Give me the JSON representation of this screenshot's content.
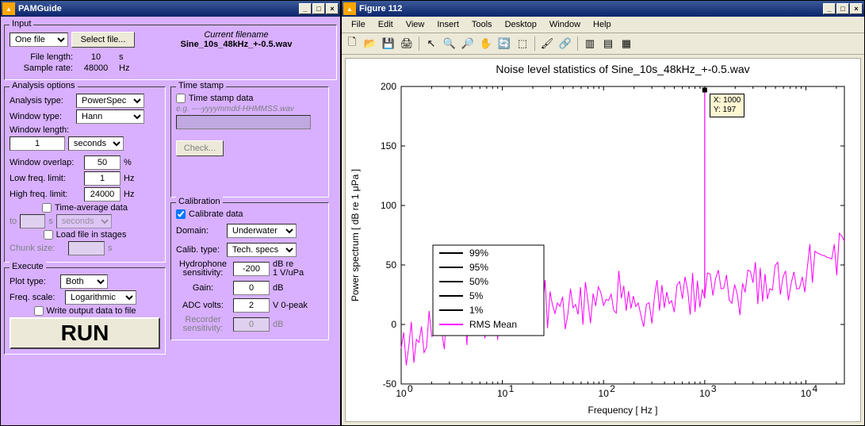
{
  "pam": {
    "title": "PAMGuide",
    "input": {
      "legend": "Input",
      "source": "One file",
      "selectFileBtn": "Select file...",
      "currentFilenameLabel": "Current filename",
      "currentFilename": "Sine_10s_48kHz_+-0.5.wav",
      "fileLengthLabel": "File length:",
      "fileLength": "10",
      "fileLengthUnit": "s",
      "sampleRateLabel": "Sample rate:",
      "sampleRate": "48000",
      "sampleRateUnit": "Hz"
    },
    "analysis": {
      "legend": "Analysis options",
      "analysisTypeLabel": "Analysis type:",
      "analysisType": "PowerSpec",
      "windowTypeLabel": "Window type:",
      "windowType": "Hann",
      "windowLengthLabel": "Window length:",
      "windowLength": "1",
      "windowLengthUnit": "seconds",
      "windowOverlapLabel": "Window overlap:",
      "windowOverlap": "50",
      "windowOverlapUnit": "%",
      "lowFreqLabel": "Low freq. limit:",
      "lowFreq": "1",
      "lowFreqUnit": "Hz",
      "highFreqLabel": "High freq. limit:",
      "highFreq": "24000",
      "highFreqUnit": "Hz",
      "timeAverageLabel": "Time-average data",
      "timeAverageChecked": false,
      "taFromLabel": "to",
      "taFrom": "",
      "taFromUnit": "s",
      "taUnit": "seconds",
      "loadStagesLabel": "Load file in stages",
      "loadStagesChecked": false,
      "chunkSizeLabel": "Chunk size:",
      "chunkSize": "",
      "chunkSizeUnit": "s"
    },
    "timestamp": {
      "legend": "Time stamp",
      "tsLabel": "Time stamp data",
      "tsChecked": false,
      "tsHint": "e.g. ----yyyymmdd-HHMMSS.wav",
      "tsValue": "",
      "checkBtn": "Check..."
    },
    "calibration": {
      "legend": "Calibration",
      "calLabel": "Calibrate data",
      "calChecked": true,
      "domainLabel": "Domain:",
      "domain": "Underwater",
      "calibTypeLabel": "Calib. type:",
      "calibType": "Tech. specs",
      "hydroLabel1": "Hydrophone",
      "hydroLabel2": "sensitivity:",
      "hydro": "-200",
      "hydroUnit1": "dB re",
      "hydroUnit2": "1 V/uPa",
      "gainLabel": "Gain:",
      "gain": "0",
      "gainUnit": "dB",
      "adcLabel": "ADC volts:",
      "adc": "2",
      "adcUnit": "V 0-peak",
      "recorderLabel1": "Recorder",
      "recorderLabel2": "sensitivity:",
      "recorder": "0",
      "recorderUnit": "dB"
    },
    "execute": {
      "legend": "Execute",
      "plotTypeLabel": "Plot type:",
      "plotType": "Both",
      "freqScaleLabel": "Freq. scale:",
      "freqScale": "Logarithmic",
      "writeLabel": "Write output data to file",
      "writeChecked": false,
      "runBtn": "RUN"
    }
  },
  "fig": {
    "title": "Figure 112",
    "menus": [
      "File",
      "Edit",
      "View",
      "Insert",
      "Tools",
      "Desktop",
      "Window",
      "Help"
    ],
    "toolbarIcons": [
      "new",
      "open",
      "save",
      "print",
      "arrow",
      "zoom-in",
      "zoom-out",
      "pan",
      "rotate",
      "cursor",
      "brush",
      "link",
      "colorbar",
      "legend",
      "grid"
    ]
  },
  "chart_data": {
    "type": "line",
    "title": "Noise level statistics of Sine_10s_48kHz_+-0.5.wav",
    "xlabel": "Frequency [ Hz ]",
    "ylabel": "Power spectrum [ dB re 1 μPa ]",
    "xlog": true,
    "xlim": [
      1,
      24000
    ],
    "ylim": [
      -50,
      200
    ],
    "yticks": [
      -50,
      0,
      50,
      100,
      150,
      200
    ],
    "xticks_exp": [
      0,
      1,
      2,
      3,
      4
    ],
    "series": [
      {
        "name": "99%",
        "color": "#000",
        "x": [],
        "values": []
      },
      {
        "name": "95%",
        "color": "#000",
        "x": [],
        "values": []
      },
      {
        "name": "50%",
        "color": "#000",
        "x": [],
        "values": []
      },
      {
        "name": "5%",
        "color": "#000",
        "x": [],
        "values": []
      },
      {
        "name": "1%",
        "color": "#000",
        "x": [],
        "values": []
      },
      {
        "name": "RMS Mean",
        "color": "#ff00ff",
        "x": [
          1,
          2,
          3,
          5,
          8,
          12,
          18,
          25,
          35,
          50,
          70,
          100,
          150,
          220,
          320,
          470,
          680,
          999,
          1000,
          1001,
          1450,
          2100,
          3000,
          4400,
          6300,
          9200,
          13000,
          18000,
          24000
        ],
        "values": [
          -20,
          -10,
          0,
          5,
          8,
          12,
          10,
          15,
          18,
          14,
          20,
          16,
          22,
          18,
          25,
          20,
          28,
          22,
          197,
          24,
          30,
          25,
          35,
          30,
          45,
          40,
          60,
          55,
          70
        ]
      }
    ],
    "legend_entries": [
      "99%",
      "95%",
      "50%",
      "5%",
      "1%",
      "RMS Mean"
    ],
    "data_tip": {
      "x_label": "X: 1000",
      "y_label": "Y: 197",
      "at_x": 1000,
      "at_y": 197
    }
  }
}
